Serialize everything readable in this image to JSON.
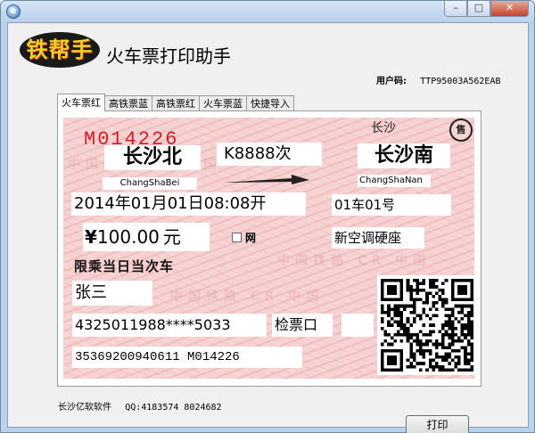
{
  "window": {
    "title": "",
    "buttons": {
      "min": "–",
      "max": "□",
      "close": "✕"
    },
    "app_icon": "ie-like-icon"
  },
  "header": {
    "logo_text": "铁帮手",
    "app_title": "火车票打印助手",
    "user_code_label": "用户码:",
    "user_code": "TTP95003A562EAB"
  },
  "tabs": [
    {
      "label": "火车票红",
      "active": true
    },
    {
      "label": "高铁票蓝",
      "active": false
    },
    {
      "label": "高铁票红",
      "active": false
    },
    {
      "label": "火车票蓝",
      "active": false
    },
    {
      "label": "快捷导入",
      "active": false
    }
  ],
  "ticket": {
    "ticket_no": "M014226",
    "sale_station": "长沙",
    "stamp": "售",
    "from_station": "长沙北",
    "from_pinyin": "ChangShaBei",
    "train_no": "K8888次",
    "to_station": "长沙南",
    "to_pinyin": "ChangShaNan",
    "datetime": "2014年01月01日08:08开",
    "seat": "01车01号",
    "price": "100.00",
    "price_yen": "¥",
    "price_unit": "元",
    "net_label": "网",
    "seat_type": "新空调硬座",
    "limit_text": "限乘当日当次车",
    "passenger_name": "张三",
    "id_number": "4325011988****5033",
    "gate_label": "检票口",
    "gate_value": "",
    "serial": "35369200940611 M014226",
    "watermark": "中国铁路 CR 中国"
  },
  "footer": {
    "company": "长沙亿软软件",
    "qq": "QQ:4183574 8024682",
    "print_label": "打印"
  }
}
